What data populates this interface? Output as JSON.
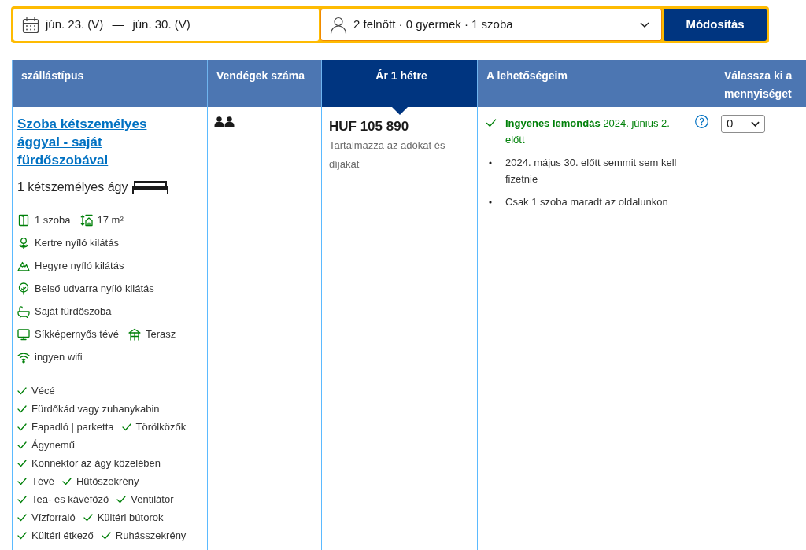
{
  "search_bar": {
    "check_in": "jún. 23. (V)",
    "date_separator": "—",
    "check_out": "jún. 30. (V)",
    "guests": "2 felnőtt · 0 gyermek · 1 szoba",
    "button": "Módosítás"
  },
  "table": {
    "columns": [
      {
        "label": "szállástípus",
        "highlighted": false
      },
      {
        "label": "Vendégek száma",
        "highlighted": false
      },
      {
        "label": "Ár 1 hétre",
        "highlighted": true
      },
      {
        "label": "A lehetőségeim",
        "highlighted": false
      },
      {
        "label": "Válassza ki a mennyiséget",
        "highlighted": false
      }
    ],
    "rows": [
      {
        "room_name": "Szoba kétszemélyes ággyal - saját fürdőszobával",
        "bed": "1 kétszemélyes ágy",
        "facilities": [
          {
            "kind": "rooms",
            "label": "1 szoba"
          },
          {
            "kind": "size",
            "label": "17 m²"
          },
          {
            "kind": "garden_view",
            "label": "Kertre nyíló kilátás"
          },
          {
            "kind": "mountain_view",
            "label": "Hegyre nyíló kilátás"
          },
          {
            "kind": "courtyard_view",
            "label": "Belső udvarra nyíló kilátás"
          },
          {
            "kind": "bathroom",
            "label": "Saját fürdőszoba"
          },
          {
            "kind": "tv",
            "label": "Síkképernyős tévé"
          },
          {
            "kind": "terrace",
            "label": "Terasz"
          },
          {
            "kind": "wifi",
            "label": "ingyen wifi"
          }
        ],
        "amenities": [
          "Vécé",
          "Fürdőkád vagy zuhanykabin",
          "Fapadló | parketta",
          "Törölközők",
          "Ágynemű",
          "Konnektor az ágy közelében",
          "Tévé",
          "Hűtőszekrény",
          "Tea- és kávéfőző",
          "Ventilátor",
          "Vízforraló",
          "Kültéri bútorok",
          "Kültéri étkező",
          "Ruhásszekrény"
        ],
        "guests": [
          {
            "kind": "adult"
          },
          {
            "kind": "adult"
          }
        ],
        "price": "HUF 105 890",
        "price_note": "Tartalmazza az adókat és díjakat",
        "conditions": [
          {
            "kind": "free_cancellation",
            "text": "**Ingyenes lemondás** 2024. június 2. előtt"
          },
          {
            "kind": "bullet",
            "text": "2024. május 30. előtt semmit sem kell fizetnie"
          },
          {
            "kind": "bullet",
            "text": "Csak 1 szoba maradt az oldalunkon"
          }
        ],
        "quantity": "0"
      }
    ]
  }
}
